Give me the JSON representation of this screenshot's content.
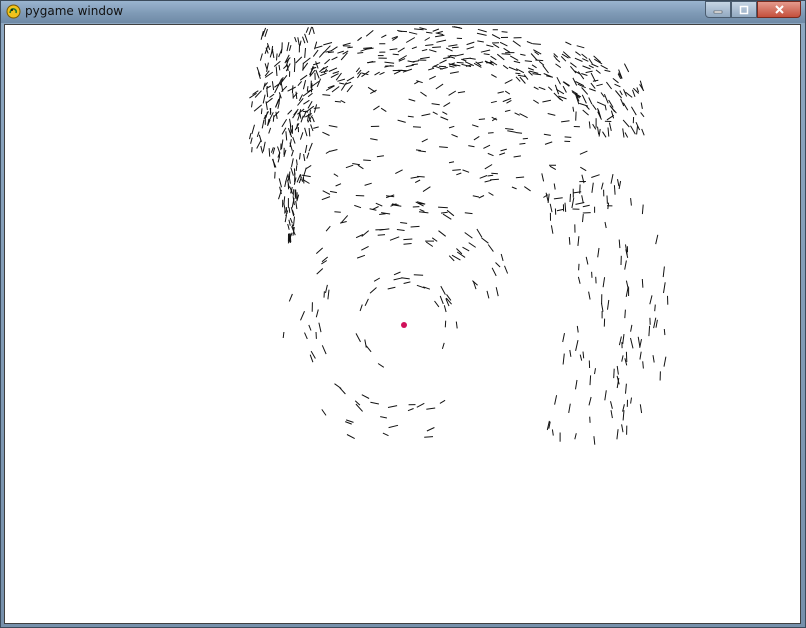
{
  "window": {
    "title": "pygame window",
    "icon": "pygame-snake-icon",
    "ghost_tabs": [
      "",
      "",
      "",
      ""
    ],
    "controls": {
      "minimize_icon": "minimize-icon",
      "maximize_icon": "maximize-icon",
      "close_icon": "close-icon"
    }
  },
  "canvas": {
    "background": "#ffffff",
    "particle_color": "#111111",
    "attractor_color": "#d0105a"
  }
}
